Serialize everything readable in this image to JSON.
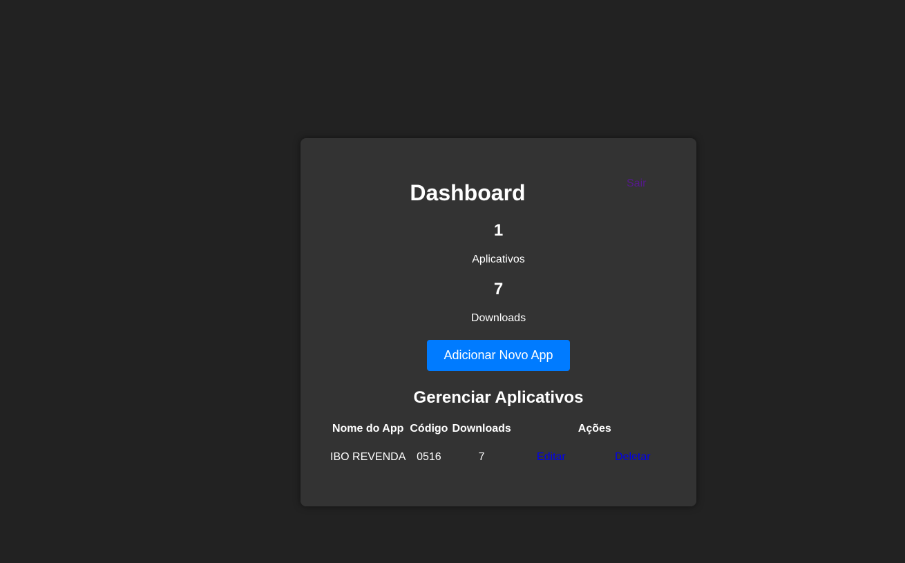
{
  "dashboard": {
    "title": "Dashboard",
    "logout_label": "Sair",
    "stats": [
      {
        "value": "1",
        "label": "Aplicativos"
      },
      {
        "value": "7",
        "label": "Downloads"
      }
    ],
    "add_button_label": "Adicionar Novo App"
  },
  "apps_section": {
    "title": "Gerenciar Aplicativos",
    "headers": [
      "Nome do App",
      "Código",
      "Downloads",
      "Ações"
    ],
    "rows": [
      {
        "name": "IBO REVENDA",
        "code": "0516",
        "downloads": "7",
        "edit_label": "Editar",
        "delete_label": "Deletar"
      }
    ]
  },
  "colors": {
    "background": "#222222",
    "card": "#333333",
    "primary_button": "#007bff",
    "link": "#0000ee",
    "visited_link": "#551a8b"
  }
}
